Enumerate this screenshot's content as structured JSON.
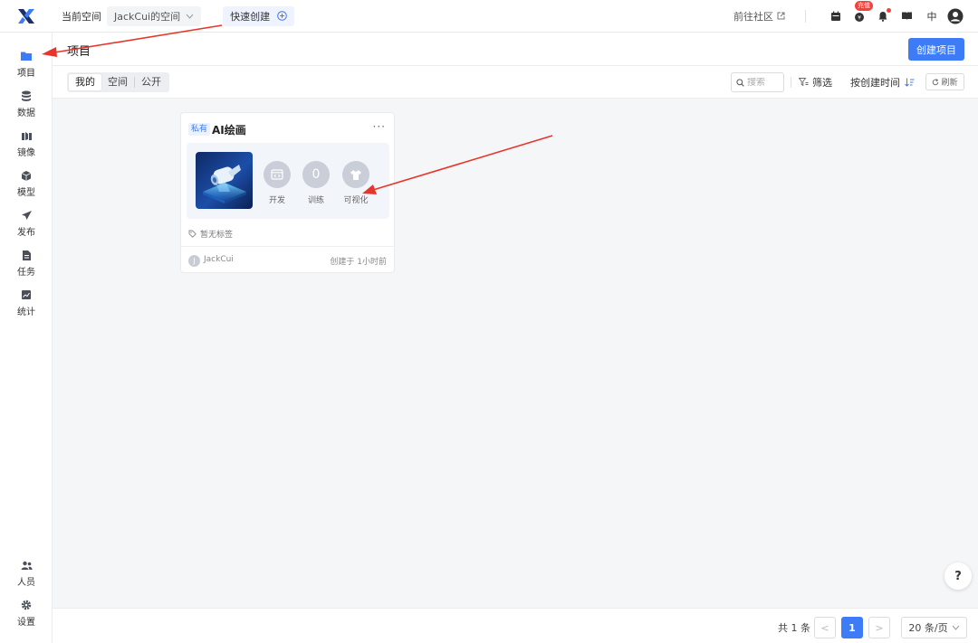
{
  "topbar": {
    "space_label": "当前空间",
    "space_value": "JackCui的空间",
    "quick_create": "快速创建",
    "community": "前往社区",
    "recharge_badge": "充值",
    "language": "中"
  },
  "sidebar": {
    "items": [
      {
        "label": "项目"
      },
      {
        "label": "数据"
      },
      {
        "label": "镜像"
      },
      {
        "label": "模型"
      },
      {
        "label": "发布"
      },
      {
        "label": "任务"
      },
      {
        "label": "统计"
      }
    ],
    "bottom": [
      {
        "label": "人员"
      },
      {
        "label": "设置"
      }
    ]
  },
  "header": {
    "title": "项目",
    "create_button": "创建项目"
  },
  "toolbar": {
    "tabs": [
      {
        "label": "我的"
      },
      {
        "label": "空间"
      },
      {
        "label": "公开"
      }
    ],
    "search_placeholder": "搜索",
    "filter": "筛选",
    "sort": "按创建时间",
    "refresh": "刷新"
  },
  "card": {
    "visibility": "私有",
    "title": "AI绘画",
    "features": [
      {
        "label": "开发",
        "icon": "code-window-icon"
      },
      {
        "label": "训练",
        "icon": "zero-count",
        "value": "0"
      },
      {
        "label": "可视化",
        "icon": "shirt-icon"
      }
    ],
    "tags": "暂无标签",
    "author": "JackCui",
    "avatar_letter": "J",
    "created": "创建于 1小时前"
  },
  "help": "?",
  "pagination": {
    "total": "共 1 条",
    "current": "1",
    "prev": "<",
    "next": ">",
    "page_size": "20 条/页"
  },
  "colors": {
    "accent": "#3d7cf6",
    "annotation": "#e8352b"
  }
}
